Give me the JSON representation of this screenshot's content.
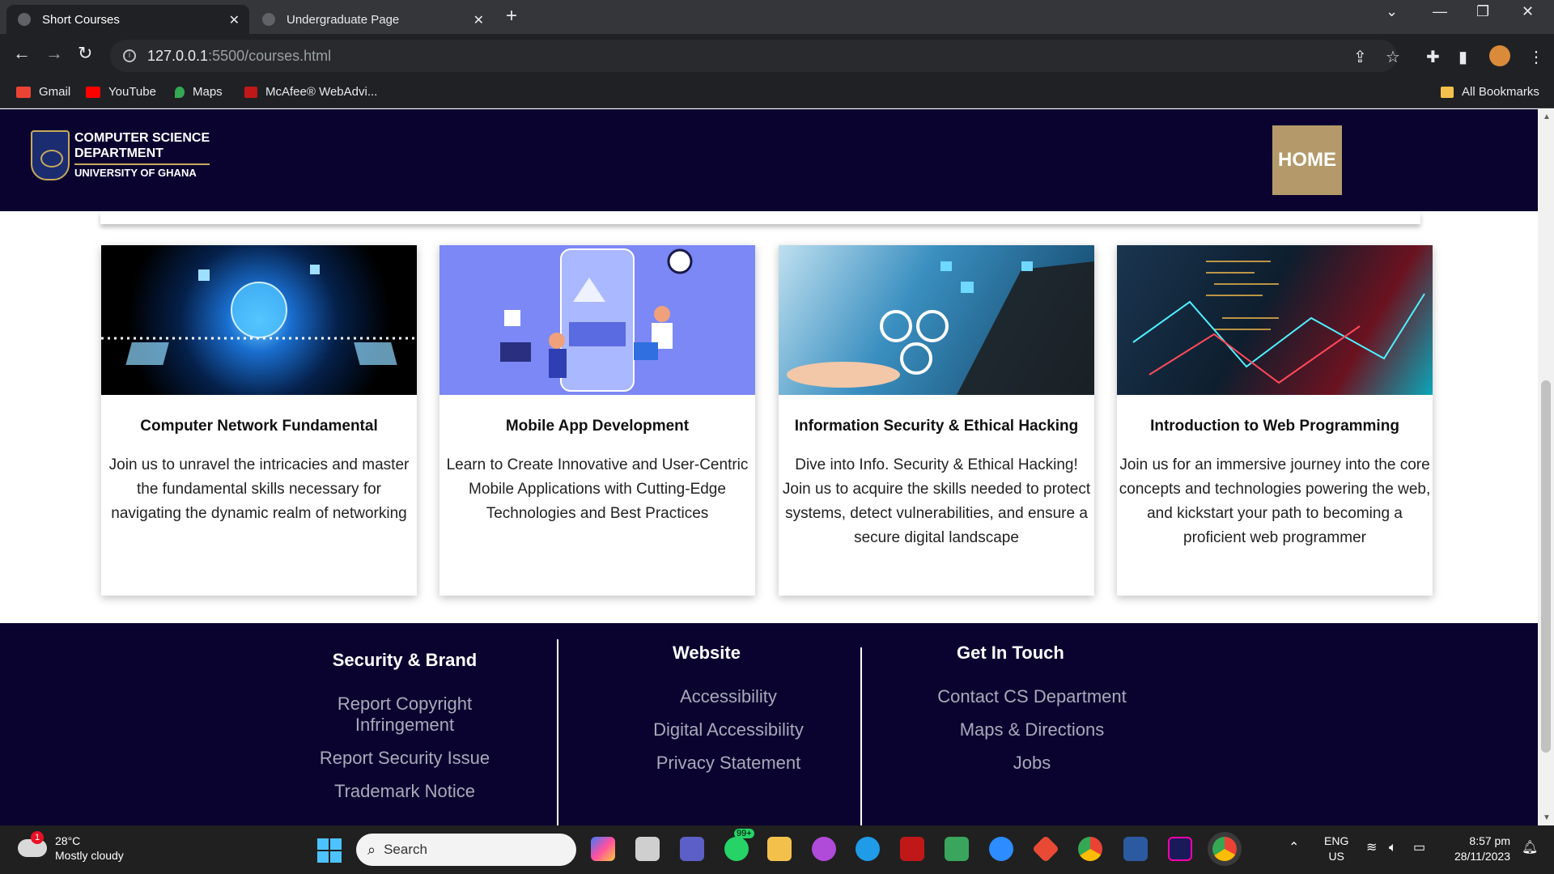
{
  "browser": {
    "tabs": [
      {
        "title": "Short Courses",
        "active": true
      },
      {
        "title": "Undergraduate Page",
        "active": false
      }
    ],
    "url_host": "127.0.0.1",
    "url_path": ":5500/courses.html",
    "bookmarks": [
      {
        "label": "Gmail",
        "icon": "gmail-icon",
        "color": "#ea4335"
      },
      {
        "label": "YouTube",
        "icon": "youtube-icon",
        "color": "#ff0000"
      },
      {
        "label": "Maps",
        "icon": "maps-icon",
        "color": "#34a853"
      },
      {
        "label": "McAfee® WebAdvi...",
        "icon": "mcafee-icon",
        "color": "#c01818"
      }
    ],
    "all_bookmarks": "All Bookmarks"
  },
  "header": {
    "logo_line1": "COMPUTER SCIENCE",
    "logo_line2": "DEPARTMENT",
    "logo_line3": "UNIVERSITY OF GHANA",
    "home_label": "HOME"
  },
  "courses": [
    {
      "title": "Computer Network Fundamental",
      "description": "Join us to unravel the intricacies and master the fundamental skills necessary for navigating the dynamic realm of networking"
    },
    {
      "title": "Mobile App Development",
      "description": "Learn to Create Innovative and User-Centric Mobile Applications with Cutting-Edge Technologies and Best Practices"
    },
    {
      "title": "Information Security & Ethical Hacking",
      "description": "Dive into Info. Security & Ethical Hacking! Join us to acquire the skills needed to protect systems, detect vulnerabilities, and ensure a secure digital landscape"
    },
    {
      "title": "Introduction to Web Programming",
      "description": "Join us for an immersive journey into the core concepts and technologies powering the web, and kickstart your path to becoming a proficient web programmer"
    }
  ],
  "footer": {
    "security": {
      "heading": "Security & Brand",
      "links": [
        "Report Copyright Infringement",
        "Report Security Issue",
        "Trademark Notice"
      ]
    },
    "website": {
      "heading": "Website",
      "links": [
        "Accessibility",
        "Digital Accessibility",
        "Privacy Statement"
      ]
    },
    "contact": {
      "heading": "Get In Touch",
      "links": [
        "Contact CS Department",
        "Maps & Directions",
        "Jobs"
      ]
    }
  },
  "taskbar": {
    "weather_temp": "28°C",
    "weather_desc": "Mostly cloudy",
    "weather_badge": "1",
    "search_placeholder": "Search",
    "whatsapp_badge": "99+",
    "lang_line1": "ENG",
    "lang_line2": "US",
    "time": "8:57 pm",
    "date": "28/11/2023"
  },
  "colors": {
    "navy": "#0a0330",
    "gold": "#b49a6a"
  }
}
